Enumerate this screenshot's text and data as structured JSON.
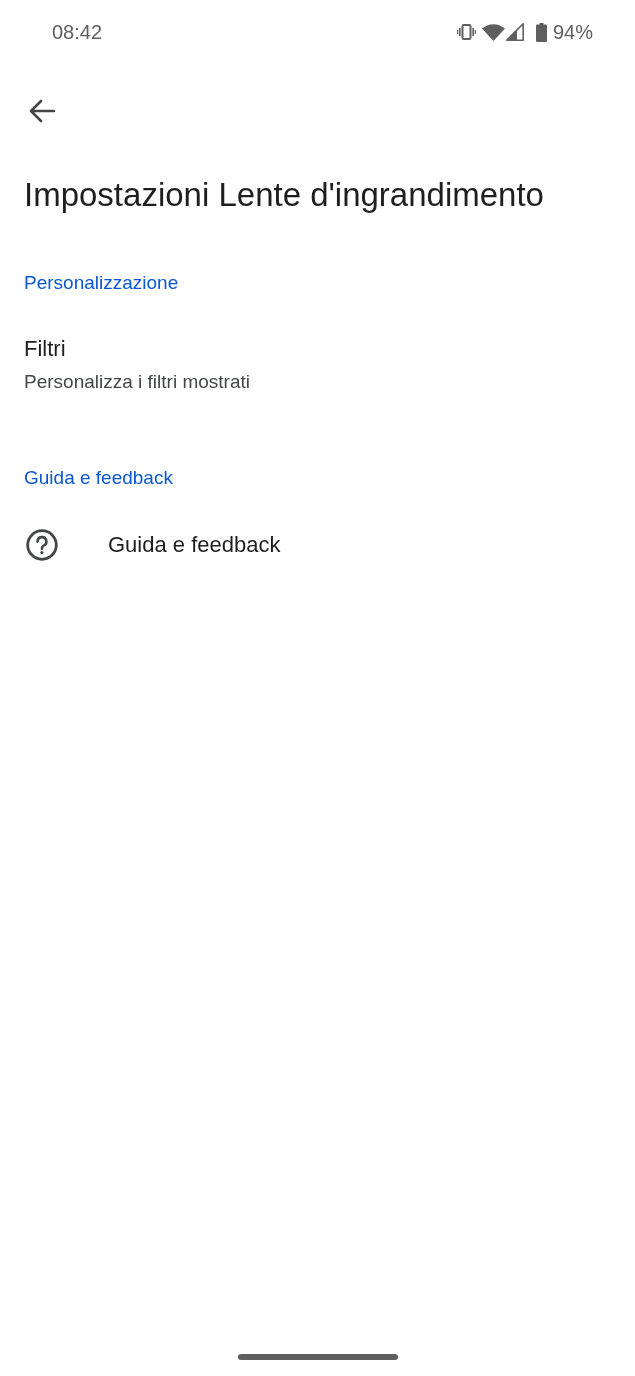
{
  "status_bar": {
    "time": "08:42",
    "battery_percent": "94%"
  },
  "title": "Impostazioni Lente d'ingrandimento",
  "sections": [
    {
      "header": "Personalizzazione",
      "items": [
        {
          "kind": "summary",
          "title": "Filtri",
          "summary": "Personalizza i filtri mostrati"
        }
      ]
    },
    {
      "header": "Guida e feedback",
      "items": [
        {
          "kind": "icon",
          "title": "Guida e feedback"
        }
      ]
    }
  ]
}
